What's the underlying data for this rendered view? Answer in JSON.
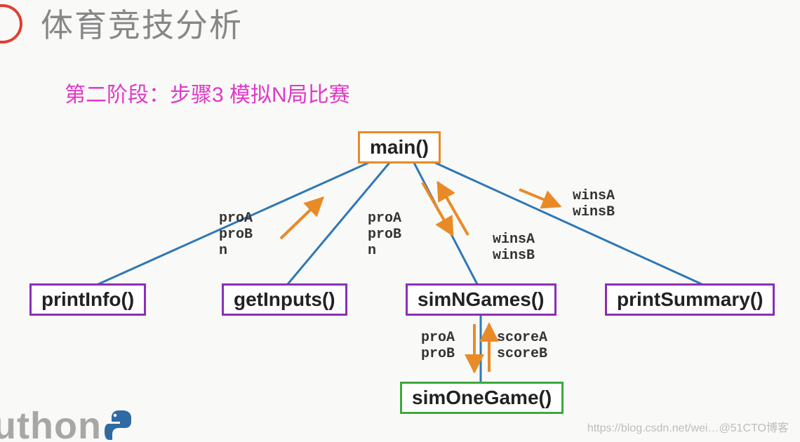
{
  "title": "体育竞技分析",
  "subtitle": "第二阶段：步骤3 模拟N局比赛",
  "nodes": {
    "main": "main()",
    "printInfo": "printInfo()",
    "getInputs": "getInputs()",
    "simNGames": "simNGames()",
    "printSummary": "printSummary()",
    "simOneGame": "simOneGame()"
  },
  "edge_labels": {
    "to_getInputs": "proA\nproB\nn",
    "to_simNGames_in": "proA\nproB\nn",
    "to_simNGames_out": "winsA\nwinsB",
    "to_printSummary": "winsA\nwinsB",
    "to_simOneGame_in": "proA\nproB",
    "to_simOneGame_out": "scoreA\nscoreB"
  },
  "watermark_logo": "uthon",
  "credit": "https://blog.csdn.net/wei…@51CTO博客",
  "colors": {
    "line": "#2f78b5",
    "arrow": "#e98a26"
  }
}
